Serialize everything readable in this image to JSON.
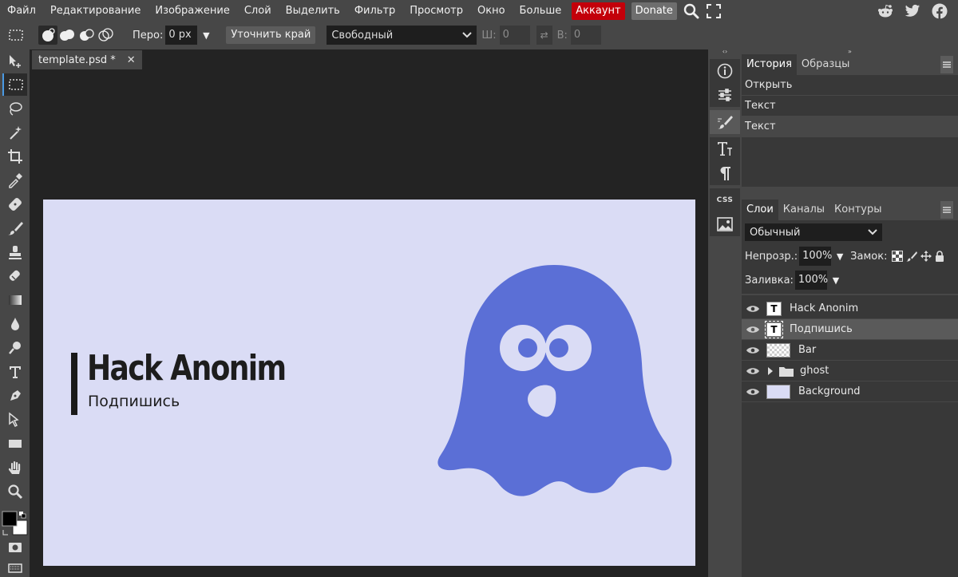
{
  "menu": {
    "items": [
      "Файл",
      "Редактирование",
      "Изображение",
      "Слой",
      "Выделить",
      "Фильтр",
      "Просмотр",
      "Окно",
      "Больше"
    ],
    "account": "Аккаунт",
    "donate": "Donate"
  },
  "options": {
    "feather_label": "Перо:",
    "feather_value": "0 px",
    "refine_edge": "Уточнить край",
    "style_value": "Свободный",
    "width_label": "Ш:",
    "width_value": "0",
    "height_label": "В:",
    "height_value": "0"
  },
  "document": {
    "tab_title": "template.psd *",
    "canvas_title": "Hack Anonim",
    "canvas_subtitle": "Подпишись",
    "canvas_bg": "#dadcf5",
    "ghost_color": "#5b6fd6"
  },
  "history": {
    "tabs": [
      "История",
      "Образцы"
    ],
    "items": [
      "Открыть",
      "Текст",
      "Текст"
    ]
  },
  "layers_panel": {
    "tabs": [
      "Слои",
      "Каналы",
      "Контуры"
    ],
    "blend_mode": "Обычный",
    "opacity_label": "Непрозр.:",
    "opacity_value": "100%",
    "lock_label": "Замок:",
    "fill_label": "Заливка:",
    "fill_value": "100%",
    "layers": [
      "Hack Anonim",
      "Подпишись",
      "Bar",
      "ghost",
      "Background"
    ]
  },
  "colors": {
    "accent": "#4a9ae4",
    "account_bg": "#c3000a",
    "selected_layer": "#5a5a5a"
  }
}
